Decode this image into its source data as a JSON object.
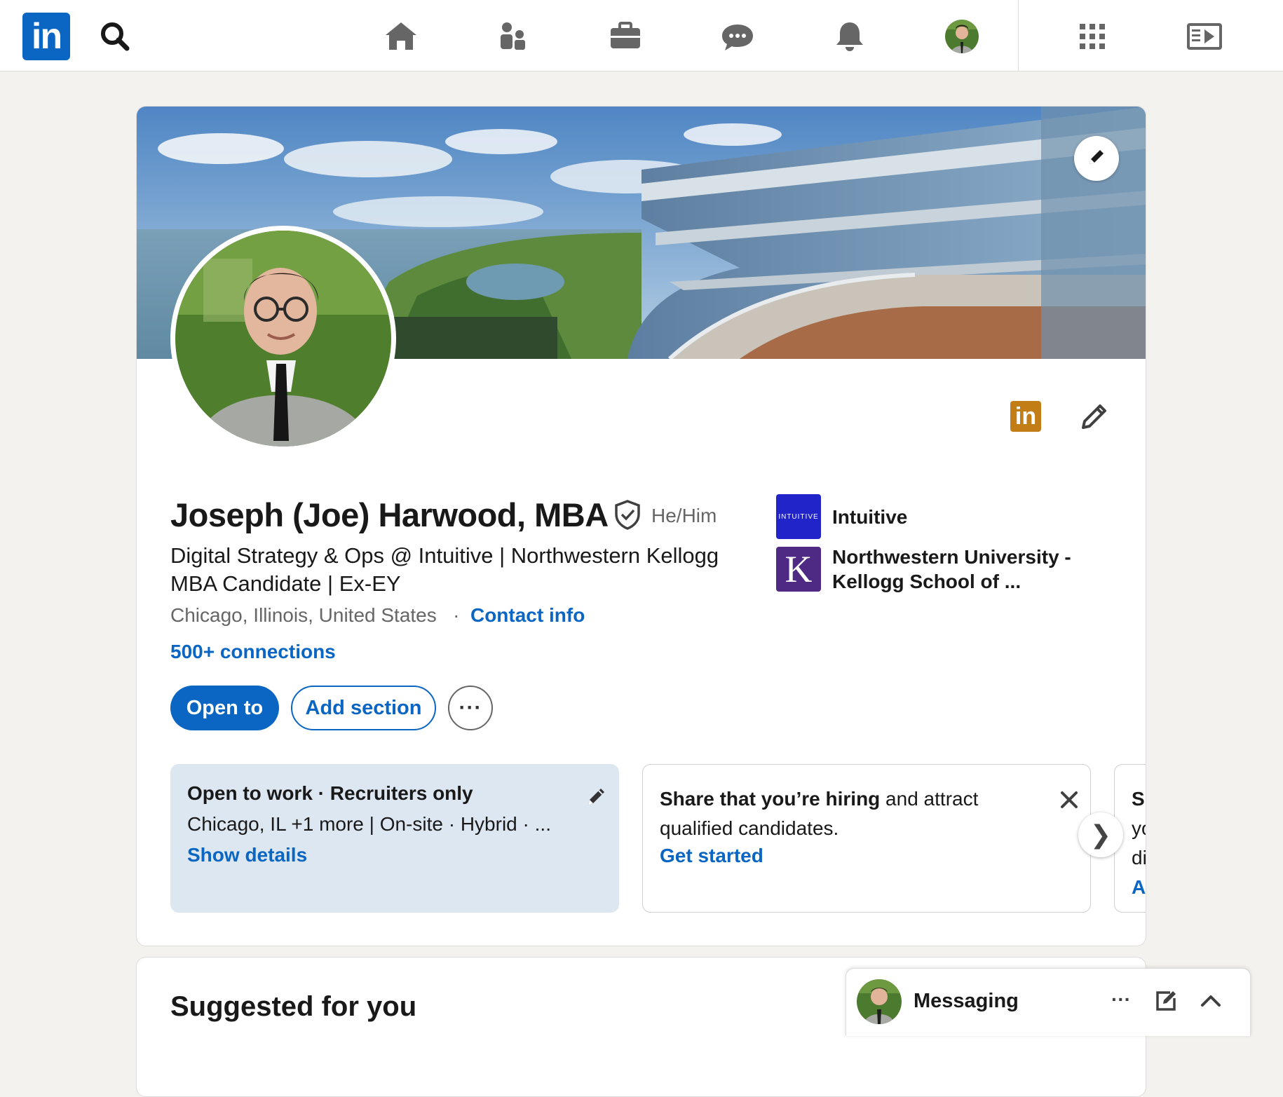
{
  "nav": {
    "logo_text": "in",
    "icons": [
      "search-icon",
      "home-icon",
      "my-network-icon",
      "jobs-icon",
      "messaging-icon",
      "notifications-icon",
      "me-avatar",
      "apps-grid-icon",
      "learning-icon"
    ],
    "accent_color": "#0a66c2"
  },
  "profile": {
    "name": "Joseph (Joe) Harwood, MBA",
    "pronouns": "He/Him",
    "headline": "Digital Strategy & Ops @ Intuitive | Northwestern Kellogg MBA Candidate | Ex-EY",
    "location": "Chicago, Illinois, United States",
    "separator": "·",
    "contact_info": "Contact info",
    "connections": "500+ connections",
    "premium_badge_text": "in",
    "companies": [
      {
        "name": "Intuitive",
        "logo_text": "INTUITIVE",
        "logo_color": "#2124c9"
      },
      {
        "name": "Northwestern University - Kellogg School of ...",
        "logo_text": "K",
        "logo_color": "#4e2a84"
      }
    ],
    "buttons": {
      "open_to": "Open to",
      "add_section": "Add section",
      "more": "···"
    }
  },
  "open_to_work": {
    "title": "Open to work · Recruiters only",
    "details": "Chicago, IL +1 more | On-site · Hybrid · ...",
    "link": "Show details"
  },
  "hiring_card": {
    "bold": "Share that you’re hiring",
    "rest": " and attract qualified candidates.",
    "link": "Get started"
  },
  "third_card": {
    "line1": "Sl",
    "line2": "yo",
    "line3": "di",
    "link": "Ac"
  },
  "carousel_next": "❯",
  "suggested": {
    "title": "Suggested for you"
  },
  "messaging": {
    "label": "Messaging",
    "more": "···"
  }
}
